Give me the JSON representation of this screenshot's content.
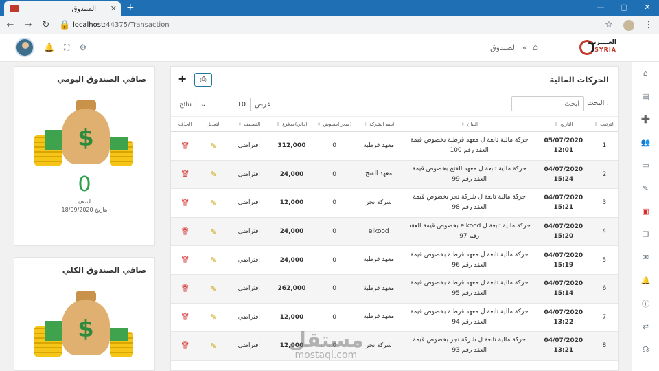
{
  "browser": {
    "tab_title": "الصندوق",
    "tab_close": "✕",
    "new_tab": "+",
    "url_host": "localhost",
    "url_path": ":44375/Transaction",
    "win_controls": [
      "—",
      "▢",
      "✕"
    ]
  },
  "header": {
    "breadcrumb": "الصندوق",
    "breadcrumb_sep": "»",
    "logo_text": "العــــربية",
    "logo_en": "SYRIA"
  },
  "sidebar": {
    "icons": [
      "home-icon",
      "book-icon",
      "user-add-icon",
      "users-icon",
      "money-icon",
      "edit-icon",
      "box-icon",
      "copy-icon",
      "comments-icon",
      "bell-icon",
      "info-icon",
      "shuffle-icon",
      "headset-icon"
    ],
    "active_index": 6,
    "glyphs": [
      "⌂",
      "▤",
      "➕",
      "👥",
      "▭",
      "✎",
      "▣",
      "❐",
      "✉",
      "🔔",
      "ⓘ",
      "⇄",
      "☊"
    ]
  },
  "main": {
    "title": "الحركات المالية",
    "print_label": "⎙",
    "add_label": "+",
    "search_label": "البحث :",
    "search_placeholder": "ابحث",
    "length_show": "عرض",
    "length_value": "10",
    "length_results": "نتائج",
    "columns": [
      "الترتيب",
      "التاريخ",
      "البيان",
      "اسم الشركة",
      "(مدين)مقبوض",
      "(دائن)مدفوع",
      "التصنيف",
      "التعديل",
      "الحذف"
    ],
    "rows": [
      {
        "num": "1",
        "date": "05/07/2020",
        "time": "12:01",
        "desc": "حركة مالية تابعة ل معهد قرطبة بخصوص قيمة العقد رقم 100",
        "company": "معهد قرطبة",
        "debit": "0",
        "credit": "312,000",
        "category": "افتراضي"
      },
      {
        "num": "2",
        "date": "04/07/2020",
        "time": "15:24",
        "desc": "حركة مالية تابعة ل معهد الفتح بخصوص قيمة العقد رقم 99",
        "company": "معهد الفتح",
        "debit": "0",
        "credit": "24,000",
        "category": "افتراضي"
      },
      {
        "num": "3",
        "date": "04/07/2020",
        "time": "15:21",
        "desc": "حركة مالية تابعة ل شركة تجر بخصوص قيمة العقد رقم 98",
        "company": "شركة تجر",
        "debit": "0",
        "credit": "12,000",
        "category": "افتراضي"
      },
      {
        "num": "4",
        "date": "04/07/2020",
        "time": "15:20",
        "desc": "حركة مالية تابعة ل elkood بخصوص قيمة العقد رقم 97",
        "company": "elkood",
        "debit": "0",
        "credit": "24,000",
        "category": "افتراضي"
      },
      {
        "num": "5",
        "date": "04/07/2020",
        "time": "15:19",
        "desc": "حركة مالية تابعة ل معهد قرطبة بخصوص قيمة العقد رقم 96",
        "company": "معهد قرطبة",
        "debit": "0",
        "credit": "24,000",
        "category": "افتراضي"
      },
      {
        "num": "6",
        "date": "04/07/2020",
        "time": "15:14",
        "desc": "حركة مالية تابعة ل معهد قرطبة بخصوص قيمة العقد رقم 95",
        "company": "معهد قرطبة",
        "debit": "0",
        "credit": "262,000",
        "category": "افتراضي"
      },
      {
        "num": "7",
        "date": "04/07/2020",
        "time": "13:22",
        "desc": "حركة مالية تابعة ل معهد قرطبة بخصوص قيمة العقد رقم 94",
        "company": "معهد قرطبة",
        "debit": "0",
        "credit": "12,000",
        "category": "افتراضي"
      },
      {
        "num": "8",
        "date": "04/07/2020",
        "time": "13:21",
        "desc": "حركة مالية تابعة ل شركة تجر بخصوص قيمة العقد رقم 93",
        "company": "شركة تجر",
        "debit": "0",
        "credit": "12,000",
        "category": "افتراضي"
      }
    ]
  },
  "daily_card": {
    "title": "صافي الصندوق اليومي",
    "amount": "0",
    "currency": "ل.س",
    "date_label": "بتاريخ 18/09/2020"
  },
  "total_card": {
    "title": "صافي الصندوق الكلي"
  },
  "watermark": {
    "arabic": "مستقل",
    "latin": "mostaql.com"
  },
  "colors": {
    "tabbar": "#1f6fb5",
    "accent_green": "#2e9e4a",
    "danger": "#d32f2f",
    "edit": "#c9a400"
  }
}
